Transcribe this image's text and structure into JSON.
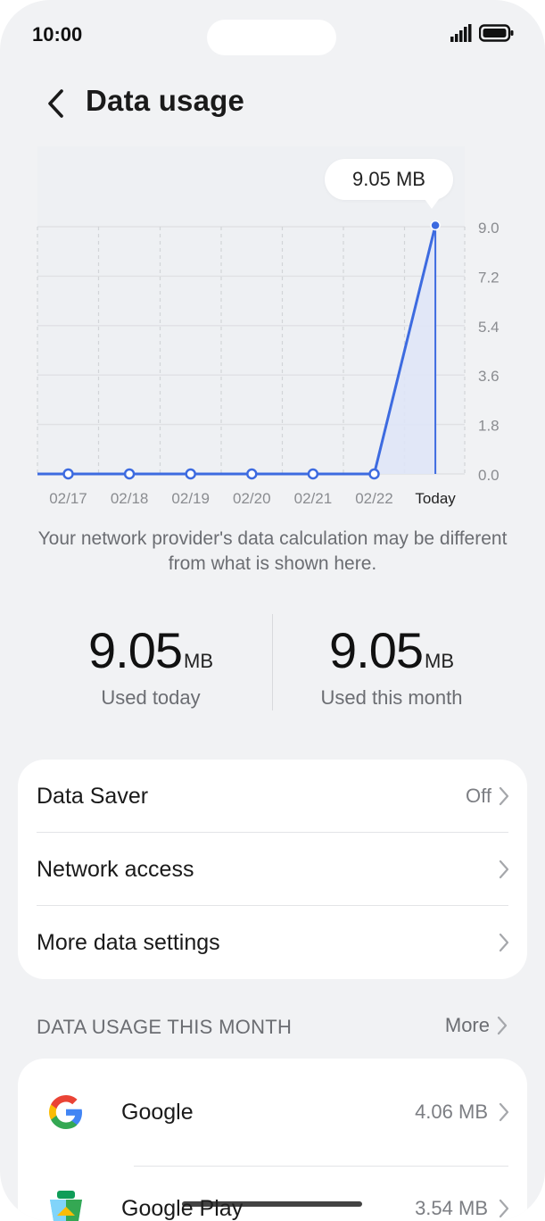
{
  "status_bar": {
    "time": "10:00"
  },
  "header": {
    "title": "Data usage"
  },
  "chart_data": {
    "type": "line",
    "categories": [
      "02/17",
      "02/18",
      "02/19",
      "02/20",
      "02/21",
      "02/22",
      "Today"
    ],
    "series": [
      {
        "values": [
          0,
          0,
          0,
          0,
          0,
          0,
          9.05
        ]
      }
    ],
    "yticks": [
      "9.0",
      "7.2",
      "5.4",
      "3.6",
      "1.8",
      "0.0"
    ],
    "ylim": [
      0,
      9.0
    ],
    "grid": true,
    "tooltip": "9.05 MB",
    "line_color": "#3d6be0",
    "fill_color": "#dfe6f7"
  },
  "disclaimer": "Your network provider's data calculation may be different from what is shown here.",
  "stats": {
    "today": {
      "value": "9.05",
      "unit": "MB",
      "label": "Used today"
    },
    "month": {
      "value": "9.05",
      "unit": "MB",
      "label": "Used this month"
    }
  },
  "settings": {
    "data_saver": {
      "label": "Data Saver",
      "value": "Off"
    },
    "network_access": {
      "label": "Network access"
    },
    "more_data_settings": {
      "label": "More data settings"
    }
  },
  "section": {
    "title": "DATA USAGE THIS MONTH",
    "more": "More"
  },
  "apps": [
    {
      "name": "Google",
      "size": "4.06 MB",
      "icon": "google-icon"
    },
    {
      "name": "Google Play",
      "size": "3.54 MB",
      "icon": "google-play-icon"
    }
  ]
}
